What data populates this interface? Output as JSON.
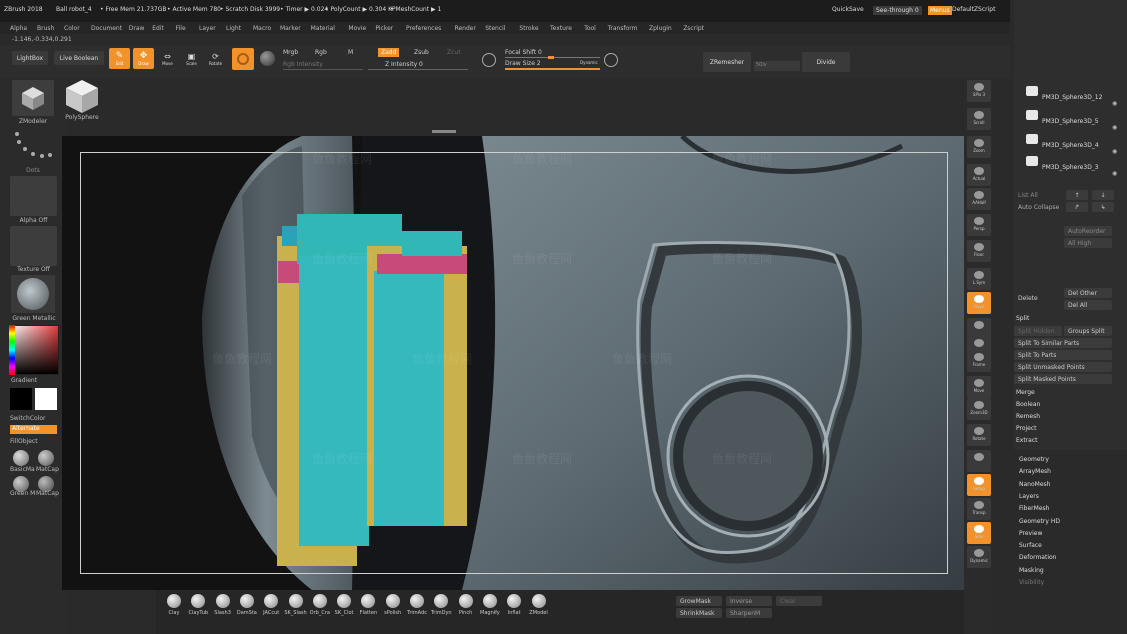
{
  "title_bar": {
    "app": "ZBrush 2018",
    "doc": "Ball robot_4",
    "free_mem": "• Free Mem 21.737GB",
    "active_mem": "• Active Mem 780",
    "scratch": "• Scratch Disk 3999",
    "timer": "• Timer ▶ 0.024",
    "polycount": "• PolyCount ▶ 0.304 KP",
    "meshcount": "• MeshCount ▶ 1",
    "quicksave": "QuickSave",
    "see_through": "See-through  0",
    "menus": "Menus",
    "default_script": "DefaultZScript"
  },
  "menu": [
    "Alpha",
    "Brush",
    "Color",
    "Document",
    "Draw",
    "Edit",
    "File",
    "Layer",
    "Light",
    "Macro",
    "Marker",
    "Material",
    "Movie",
    "Picker",
    "Preferences",
    "Render",
    "Stencil",
    "Stroke",
    "Texture",
    "Tool",
    "Transform",
    "Zplugin",
    "Zscript"
  ],
  "coords": "-1.146,-0.334,0.291",
  "toolbar": {
    "lightbox": "LightBox",
    "live_boolean": "Live Boolean",
    "edit": "Edit",
    "draw": "Draw",
    "move": "Move",
    "scale": "Scale",
    "rotate": "Rotate",
    "mrgb": "Mrgb",
    "rgb": "Rgb",
    "m": "M",
    "rgb_intensity": "Rgb Intensity",
    "zadd": "Zadd",
    "zsub": "Zsub",
    "zcut": "Zcut",
    "z_intensity": "Z Intensity 0",
    "focal_shift": "Focal Shift 0",
    "draw_size": "Draw Size 2",
    "dynamic": "Dynamic",
    "zremesher": "ZRemesher",
    "divide": "Divide",
    "zr_value": "50lv"
  },
  "left_shelf": {
    "zmodeler": "ZModeler",
    "polysphere": "PolySphere",
    "dots": "Dots",
    "alpha_off": "Alpha Off",
    "texture_off": "Texture Off",
    "green_metallic": "Green Metallic",
    "gradient": "Gradient",
    "switch_color": "SwitchColor",
    "alternate": "Alternate",
    "fill_object": "FillObject",
    "mat1": "BasicMa",
    "mat2": "MatCap",
    "mat3": "Green M",
    "mat4": "MatCap",
    "colors": {
      "primary": "#000000",
      "secondary": "#ffffff",
      "accent": "#f2922a"
    }
  },
  "right_shelf": [
    "SPix 3",
    "Scroll",
    "Zoom",
    "Actual",
    "AAHalf",
    "Persp",
    "Floor",
    "L.Sym",
    "Gxyz",
    "",
    "",
    "Frame",
    "Move",
    "Zoom3D",
    "Rotate",
    "",
    "Setup",
    "Transp",
    "Solo",
    "Dynamic"
  ],
  "subtools": [
    {
      "name": "PM3D_Sphere3D_12"
    },
    {
      "name": "PM3D_Sphere3D_5"
    },
    {
      "name": "PM3D_Sphere3D_4"
    },
    {
      "name": "PM3D_Sphere3D_3"
    }
  ],
  "subtool_ops": {
    "list_all": "List All",
    "auto_collapse": "Auto Collapse",
    "auto_reorder": "AutoReorder",
    "all_high": "All High",
    "delete": "Delete",
    "del_other": "Del Other",
    "del_all": "Del All",
    "split": "Split",
    "split_hidden": "Split Hidden",
    "groups_split": "Groups Split",
    "split_similar": "Split To Similar Parts",
    "split_parts": "Split To Parts",
    "split_unmasked": "Split Unmasked Points",
    "split_masked": "Split Masked Points",
    "merge": "Merge",
    "boolean": "Boolean",
    "remesh": "Remesh",
    "project": "Project",
    "extract": "Extract"
  },
  "tool_sections": [
    "Geometry",
    "ArrayMesh",
    "NanoMesh",
    "Layers",
    "FiberMesh",
    "Geometry HD",
    "Preview",
    "Surface",
    "Deformation",
    "Masking",
    "Visibility"
  ],
  "brushes": [
    "Clay",
    "ClayTub",
    "Slash3",
    "DamSta",
    "JACcut",
    "SK_Slash",
    "Orb_Cra",
    "SK_Clot",
    "Flatten",
    "sPolish",
    "TrimAdc",
    "TrimDyn",
    "Pinch",
    "Magnify",
    "Inflat",
    "ZModel"
  ],
  "bottom_right": {
    "grow_mask": "GrowMask",
    "shrink_mask": "ShrinkMask",
    "inverse": "Inverse",
    "sharpen": "SharpenM",
    "clear": "Clear"
  },
  "watermark": "鱼鱼教程网"
}
